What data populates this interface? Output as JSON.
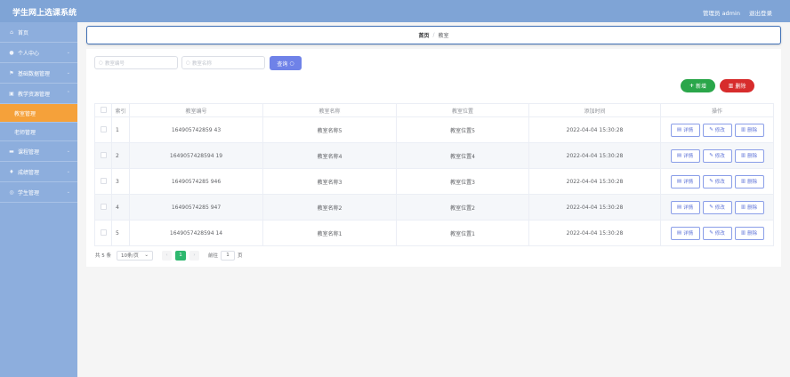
{
  "app": {
    "title": "学生网上选课系统",
    "user": "管理员 admin",
    "logout": "退出登录"
  },
  "sidebar": {
    "items": [
      {
        "label": "首页",
        "icon": "home-icon"
      },
      {
        "label": "个人中心",
        "icon": "user-icon"
      },
      {
        "label": "基础数据管理",
        "icon": "flag-icon"
      },
      {
        "label": "教学资源管理",
        "icon": "folder-icon"
      }
    ],
    "subitems": [
      {
        "label": "教室管理",
        "active": true
      },
      {
        "label": "老师管理",
        "active": false
      }
    ],
    "items_after": [
      {
        "label": "课程管理",
        "icon": "chat-icon"
      },
      {
        "label": "成绩管理",
        "icon": "pin-icon"
      },
      {
        "label": "学生管理",
        "icon": "user-group-icon"
      }
    ]
  },
  "breadcrumb": {
    "home": "首页",
    "separator": "/",
    "current": "教室"
  },
  "search": {
    "code_placeholder": "教室编号",
    "name_placeholder": "教室名称",
    "query_label": "查询"
  },
  "actions": {
    "add_label": "新增",
    "delete_label": "删除"
  },
  "table": {
    "headers": [
      "",
      "索引",
      "教室编号",
      "教室名称",
      "教室位置",
      "添加时间",
      "操作"
    ],
    "rows": [
      {
        "index": "1",
        "code": "164905742859 43",
        "name": "教室名称5",
        "location": "教室位置5",
        "added": "2022-04-04 15:30:28"
      },
      {
        "index": "2",
        "code": "1649057428594 19",
        "name": "教室名称4",
        "location": "教室位置4",
        "added": "2022-04-04 15:30:28"
      },
      {
        "index": "3",
        "code": "16490574285 946",
        "name": "教室名称3",
        "location": "教室位置3",
        "added": "2022-04-04 15:30:28"
      },
      {
        "index": "4",
        "code": "16490574285 947",
        "name": "教室名称2",
        "location": "教室位置2",
        "added": "2022-04-04 15:30:28"
      },
      {
        "index": "5",
        "code": "1649057428594 14",
        "name": "教室名称1",
        "location": "教室位置1",
        "added": "2022-04-04 15:30:28"
      }
    ],
    "row_actions": {
      "detail": "详情",
      "edit": "修改",
      "delete": "删除"
    }
  },
  "pagination": {
    "total": "共 5 条",
    "page_size": "10条/页",
    "current_page": "1",
    "goto_prefix": "前往",
    "goto_value": "1",
    "goto_suffix": "页"
  },
  "colors": {
    "topbar": "#7fa4d6",
    "sidebar": "#8daedd",
    "active_menu": "#f5a13a",
    "query": "#6f82e8",
    "add": "#2aa64a",
    "delete": "#d72c2c",
    "page": "#2fb86f"
  }
}
